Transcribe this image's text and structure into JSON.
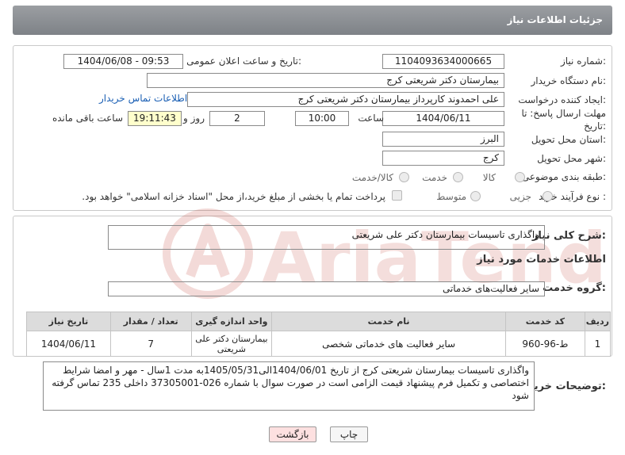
{
  "header": {
    "title": "جزئیات اطلاعات نیاز"
  },
  "form": {
    "need_number_label": "شماره نیاز:",
    "need_number": "1104093634000665",
    "announce_label": "تاریخ و ساعت اعلان عمومی:",
    "announce_value": "1404/06/08 - 09:53",
    "buyer_org_label": "نام دستگاه خریدار:",
    "buyer_org": "بیمارستان دکتر شریعتی کرج",
    "requester_label": "ایجاد کننده درخواست:",
    "requester": "علی احمدوند کارپرداز بیمارستان دکتر شریعتی کرج",
    "contact_link": "اطلاعات تماس خریدار",
    "deadline_label_1": "مهلت ارسال پاسخ: تا",
    "deadline_label_2": "تاریخ:",
    "deadline_date": "1404/06/11",
    "time_label": "ساعت",
    "deadline_time": "10:00",
    "days_value": "2",
    "days_label": "روز و",
    "remaining_time": "19:11:43",
    "remaining_label": "ساعت باقی مانده",
    "province_label": "استان محل تحویل:",
    "province": "البرز",
    "city_label": "شهر محل تحویل:",
    "city": "کرج",
    "category_label": "طبقه بندی موضوعی:",
    "category_options": [
      "کالا",
      "خدمت",
      "کالا/خدمت"
    ],
    "process_label": "نوع فرآیند خرید :",
    "process_options": [
      "جزیی",
      "متوسط"
    ],
    "payment_note": "پرداخت تمام یا بخشی از مبلغ خرید،از محل \"اسناد خزانه اسلامی\" خواهد بود."
  },
  "summary": {
    "label": "شرح کلی نیاز:",
    "value": "واگذاری تاسیسات بیمارستان دکتر علی شریعتی"
  },
  "services": {
    "section_title": "اطلاعات خدمات مورد نیاز",
    "group_label": "گروه خدمت:",
    "group_value": "سایر فعالیت‌های خدماتی",
    "columns": [
      "ردیف",
      "کد خدمت",
      "نام خدمت",
      "واحد اندازه گیری",
      "تعداد / مقدار",
      "تاریخ نیاز"
    ],
    "rows": [
      [
        "1",
        "ط-96-960",
        "سایر فعالیت های خدماتی شخصی",
        "بیمارستان دکتر علی شریعتی",
        "7",
        "1404/06/11"
      ]
    ]
  },
  "buyer_notes": {
    "label": "توضیحات خریدار:",
    "value": "واگذاری تاسیسات بیمارستان شریعتی کرج از تاریخ 1404/06/01الی1405/05/31به مدت 1سال - مهر و امضا شرایط اختصاصی و تکمیل فرم پیشنهاد قیمت الزامی است در صورت سوال با شماره 026-37305001 داخلی 235 تماس گرفته شود"
  },
  "buttons": {
    "print": "چاپ",
    "back": "بازگشت"
  },
  "watermark": {
    "text": "AriaTender.neT"
  },
  "colors": {
    "header": "#8a8d91",
    "link": "#1a5fb4",
    "back_button": "#fde0e0",
    "yellow_field": "#ffffcc"
  }
}
